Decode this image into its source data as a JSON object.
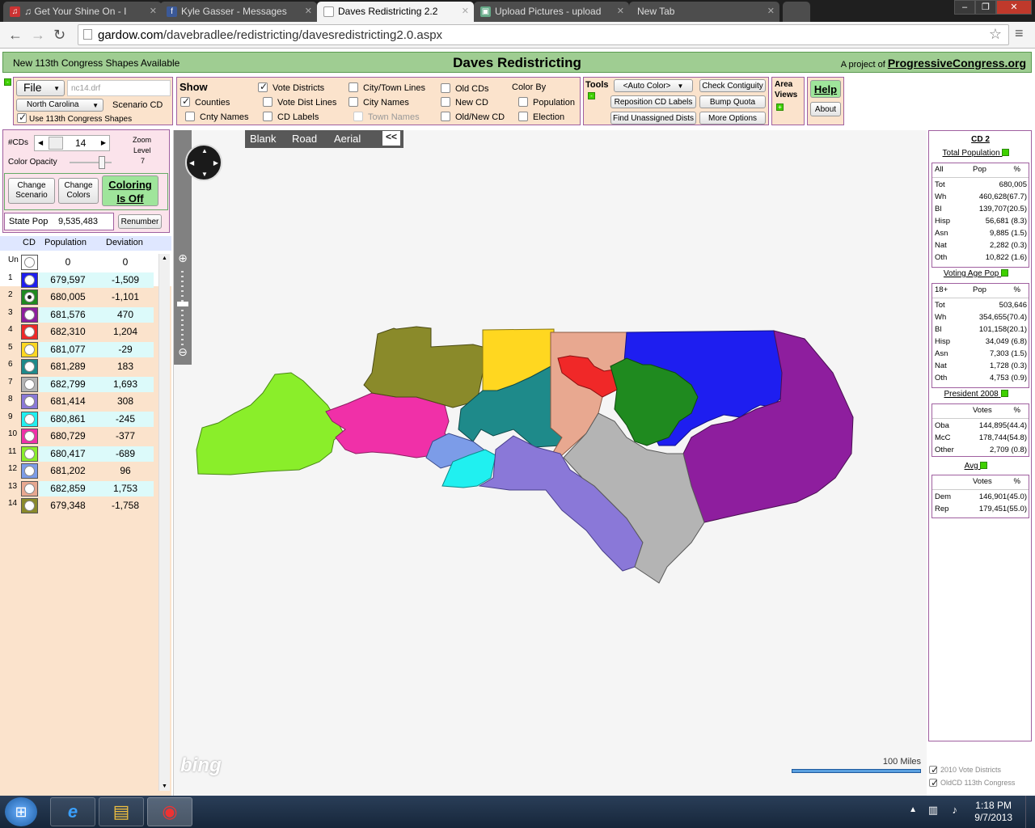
{
  "browser": {
    "tabs": [
      {
        "title": "♫ Get Your Shine On - I",
        "icon": "music-icon"
      },
      {
        "title": "Kyle Gasser - Messages",
        "icon": "facebook-icon"
      },
      {
        "title": "Daves Redistricting 2.2",
        "icon": "page-icon"
      },
      {
        "title": "Upload Pictures - upload",
        "icon": "image-icon"
      },
      {
        "title": "New Tab",
        "icon": ""
      }
    ],
    "url_host": "gardow.com",
    "url_path": "/davebradlee/redistricting/davesredistricting2.0.aspx"
  },
  "banner": {
    "left": "New 113th Congress Shapes Available",
    "title": "Daves Redistricting",
    "right_prefix": "A project of",
    "right_link": "ProgressiveCongress.org"
  },
  "file_panel": {
    "file_label": "File",
    "filename_placeholder": "nc14.drf",
    "state": "North Carolina",
    "scenario": "Scenario CD",
    "use_113": "Use 113th Congress Shapes"
  },
  "show_panel": {
    "title": "Show",
    "vote_districts": "Vote Districts",
    "counties": "Counties",
    "vote_dist_lines": "Vote Dist Lines",
    "cnty_names": "Cnty Names",
    "cd_labels": "CD Labels",
    "city_town_lines": "City/Town Lines",
    "city_names": "City Names",
    "town_names": "Town Names",
    "old_cds": "Old CDs",
    "new_cd": "New CD",
    "old_new_cd": "Old/New CD",
    "color_by": "Color By",
    "population": "Population",
    "election": "Election"
  },
  "tools_panel": {
    "title": "Tools",
    "auto_color": "<Auto Color>",
    "reposition": "Reposition CD Labels",
    "find_unassigned": "Find Unassigned Dists",
    "check_contiguity": "Check Contiguity",
    "bump_quota": "Bump Quota",
    "more_options": "More Options"
  },
  "area_views": {
    "line1": "Area",
    "line2": "Views"
  },
  "help": {
    "help": "Help",
    "about": "About"
  },
  "left_controls": {
    "cds_label": "#CDs",
    "cds_value": "14",
    "color_opacity": "Color Opacity",
    "zoom_label1": "Zoom",
    "zoom_label2": "Level",
    "zoom_value": "7",
    "change_scenario1": "Change",
    "change_scenario2": "Scenario",
    "change_colors1": "Change",
    "change_colors2": "Colors",
    "coloring1": "Coloring",
    "coloring2": "Is Off",
    "state_pop_label": "State Pop",
    "state_pop_value": "9,535,483",
    "renumber": "Renumber"
  },
  "cd_table": {
    "headers": [
      "CD",
      "Population",
      "Deviation"
    ],
    "rows": [
      {
        "cd": "Un",
        "color": "#ffffff",
        "pop": "0",
        "dev": "0"
      },
      {
        "cd": "1",
        "color": "#1e1ef0",
        "pop": "679,597",
        "dev": "-1,509"
      },
      {
        "cd": "2",
        "color": "#1f8a1f",
        "pop": "680,005",
        "dev": "-1,101"
      },
      {
        "cd": "3",
        "color": "#8e1e9e",
        "pop": "681,576",
        "dev": "470"
      },
      {
        "cd": "4",
        "color": "#f02828",
        "pop": "682,310",
        "dev": "1,204"
      },
      {
        "cd": "5",
        "color": "#ffd720",
        "pop": "681,077",
        "dev": "-29"
      },
      {
        "cd": "6",
        "color": "#1e8a8a",
        "pop": "681,289",
        "dev": "183"
      },
      {
        "cd": "7",
        "color": "#b4b4b4",
        "pop": "682,799",
        "dev": "1,693"
      },
      {
        "cd": "8",
        "color": "#8a78d8",
        "pop": "681,414",
        "dev": "308"
      },
      {
        "cd": "9",
        "color": "#20f0f0",
        "pop": "680,861",
        "dev": "-245"
      },
      {
        "cd": "10",
        "color": "#f030a8",
        "pop": "680,729",
        "dev": "-377"
      },
      {
        "cd": "11",
        "color": "#8aee2a",
        "pop": "680,417",
        "dev": "-689"
      },
      {
        "cd": "12",
        "color": "#7c9ce8",
        "pop": "681,202",
        "dev": "96"
      },
      {
        "cd": "13",
        "color": "#e8a890",
        "pop": "682,859",
        "dev": "1,753"
      },
      {
        "cd": "14",
        "color": "#8a8a2a",
        "pop": "679,348",
        "dev": "-1,758"
      }
    ]
  },
  "map": {
    "types": [
      "Blank",
      "Road",
      "Aerial"
    ],
    "collapse": "<<",
    "scale_label": "100 Miles",
    "logo": "bing"
  },
  "right_panel": {
    "title": "CD 2",
    "total_pop_title": "Total Population",
    "total_pop_head": [
      "All",
      "Pop",
      "%"
    ],
    "total_pop": [
      [
        "Tot",
        "680,005"
      ],
      [
        "Wh",
        "460,628(67.7)"
      ],
      [
        "Bl",
        "139,707(20.5)"
      ],
      [
        "Hisp",
        "56,681 (8.3)"
      ],
      [
        "Asn",
        "9,885 (1.5)"
      ],
      [
        "Nat",
        "2,282 (0.3)"
      ],
      [
        "Oth",
        "10,822 (1.6)"
      ]
    ],
    "vap_title": "Voting Age Pop",
    "vap_head": [
      "18+",
      "Pop",
      "%"
    ],
    "vap": [
      [
        "Tot",
        "503,646"
      ],
      [
        "Wh",
        "354,655(70.4)"
      ],
      [
        "Bl",
        "101,158(20.1)"
      ],
      [
        "Hisp",
        "34,049 (6.8)"
      ],
      [
        "Asn",
        "7,303 (1.5)"
      ],
      [
        "Nat",
        "1,728 (0.3)"
      ],
      [
        "Oth",
        "4,753 (0.9)"
      ]
    ],
    "pres_title": "President 2008",
    "pres_head": [
      "",
      "Votes",
      "%"
    ],
    "pres": [
      [
        "Oba",
        "144,895(44.4)"
      ],
      [
        "McC",
        "178,744(54.8)"
      ],
      [
        "Other",
        "2,709 (0.8)"
      ]
    ],
    "avg_title": "Avg",
    "avg_head": [
      "",
      "Votes",
      "%"
    ],
    "avg": [
      [
        "Dem",
        "146,901(45.0)"
      ],
      [
        "Rep",
        "179,451(55.0)"
      ]
    ],
    "legend1": "2010 Vote Districts",
    "legend2": "OldCD 113th Congress"
  },
  "taskbar": {
    "time": "1:18 PM",
    "date": "9/7/2013"
  }
}
